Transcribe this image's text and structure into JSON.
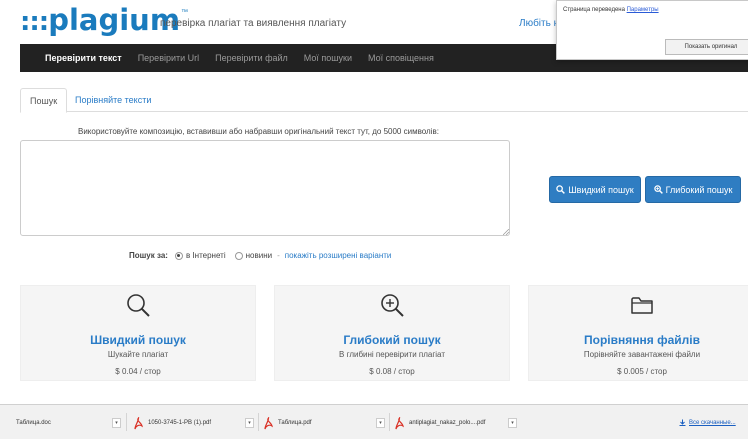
{
  "header": {
    "logo_dots": ":::",
    "logo_word": "plagium",
    "logo_tm": "™",
    "tagline": "перевірка плагіат та виявлення плагіату",
    "like_link": "Любіть н"
  },
  "nav": {
    "items": [
      {
        "label": "Перевірити текст",
        "active": true
      },
      {
        "label": "Перевірити Url",
        "active": false
      },
      {
        "label": "Перевірити файл",
        "active": false
      },
      {
        "label": "Мої пошуки",
        "active": false
      },
      {
        "label": "Мої сповіщення",
        "active": false
      }
    ]
  },
  "translate_popup": {
    "text": "Страница переведена",
    "link": "Параметры",
    "button": "Показать оригинал"
  },
  "tabs": [
    {
      "label": "Пошук",
      "active": true
    },
    {
      "label": "Порівняйте тексти",
      "active": false
    }
  ],
  "main": {
    "instructions": "Використовуйте композицію, вставивши або набравши оригінальний текст тут, до 5000 символів:",
    "textarea_value": "",
    "quick_search_button": "Швидкий пошук",
    "deep_search_button": "Глибокий пошук"
  },
  "search_options": {
    "label": "Пошук за:",
    "opt_internet": "в Інтернеті",
    "opt_news": "новини",
    "dash": "-",
    "advanced_link": "покажіть розширені варіанти",
    "selected": "internet"
  },
  "cards": [
    {
      "icon": "magnifier-icon",
      "title": "Швидкий пошук",
      "desc": "Шукайте плагіат",
      "price": "$ 0.04 / стор"
    },
    {
      "icon": "magnifier-plus-icon",
      "title": "Глибокий пошук",
      "desc": "В глибині перевірити плагіат",
      "price": "$ 0.08 / стор"
    },
    {
      "icon": "folder-icon",
      "title": "Порівняння файлів",
      "desc": "Порівняйте завантажені файли",
      "price": "$ 0.005 / стор"
    }
  ],
  "downloads": {
    "items": [
      {
        "name": "Таблица.doc",
        "type": "doc"
      },
      {
        "name": "1050-3745-1-PB (1).pdf",
        "type": "pdf"
      },
      {
        "name": "Таблица.pdf",
        "type": "pdf"
      },
      {
        "name": "antiplagiat_nakaz_polo....pdf",
        "type": "pdf"
      }
    ],
    "arrow": "▾",
    "show_all": "Все скачанные..."
  },
  "colors": {
    "brand_blue": "#1a7bbd",
    "button_blue": "#2f7dc2",
    "link_blue": "#2a7cc7",
    "nav_bg": "#222222",
    "pdf_red": "#d93025"
  }
}
